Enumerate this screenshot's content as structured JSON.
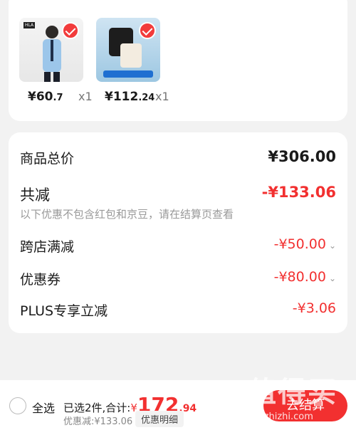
{
  "items": [
    {
      "price_main": "¥60",
      "price_decimal": ".7",
      "qty": "x1"
    },
    {
      "price_main": "¥112",
      "price_decimal": ".24",
      "qty": "x1"
    }
  ],
  "summary": {
    "total_label": "商品总价",
    "total_value": "¥306.00",
    "discount_label": "共减",
    "discount_value": "-¥133.06",
    "discount_note": "以下优惠不包含红包和京豆，请在结算页查看",
    "rows": [
      {
        "label": "跨店满减",
        "value": "-¥50.00"
      },
      {
        "label": "优惠券",
        "value": "-¥80.00"
      },
      {
        "label": "PLUS专享立减",
        "value": "-¥3.06"
      }
    ]
  },
  "footer": {
    "select_all": "全选",
    "selected_text": "已选2件,合计:",
    "yen": "¥",
    "amount": "172",
    "amount_decimal": ".94",
    "discount_text": "优惠减:¥133.06",
    "detail_button": "优惠明细",
    "checkout_button": "去结算"
  },
  "watermark": {
    "text": "值得买",
    "url": "zhizhizhi.com"
  },
  "colors": {
    "accent": "#f23030"
  }
}
